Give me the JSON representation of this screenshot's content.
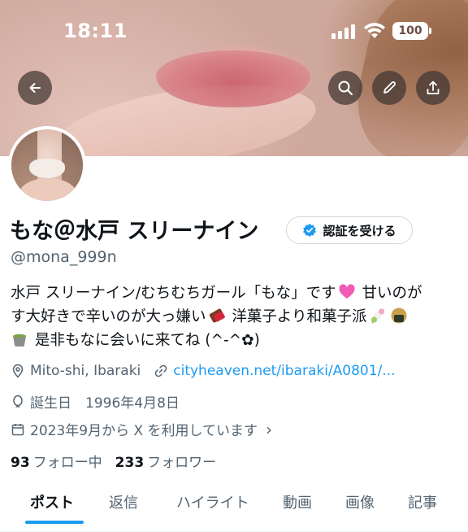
{
  "status_bar": {
    "time": "18:11",
    "battery": "100"
  },
  "profile": {
    "name": "もな＠水戸 スリーナイン",
    "handle": "@mona_999n",
    "verify_label": "認証を受ける",
    "bio_lines": [
      "水戸 スリーナイン/むちむちガール「もな」です",
      " 甘いのが",
      "す大好きで辛いのが大っ嫌い",
      " 洋菓子より和菓子派",
      " 是非もなに会いに来てね (^-^✿)"
    ],
    "location": "Mito-shi, Ibaraki",
    "website": "cityheaven.net/ibaraki/A0801/...",
    "birthday": "誕生日　1996年4月8日",
    "joined": "2023年9月から X を利用しています",
    "joined_chevron": "›",
    "following_count": "93",
    "following_label": "フォロー中",
    "followers_count": "233",
    "followers_label": "フォロワー"
  },
  "tabs": [
    {
      "label": "ポスト"
    },
    {
      "label": "返信"
    },
    {
      "label": "ハイライト"
    },
    {
      "label": "動画"
    },
    {
      "label": "画像"
    },
    {
      "label": "記事"
    }
  ],
  "colors": {
    "accent": "#1d9bf0",
    "secondary_text": "#536471",
    "primary_text": "#0f1419"
  },
  "icons": [
    "back-arrow-icon",
    "search-icon",
    "edit-pencil-icon",
    "share-icon",
    "verified-badge-icon",
    "location-pin-icon",
    "link-icon",
    "balloon-icon",
    "calendar-icon"
  ]
}
